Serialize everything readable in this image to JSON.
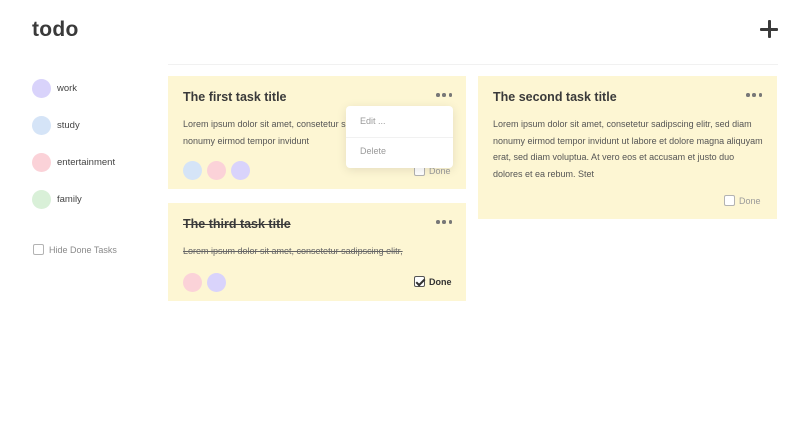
{
  "app": {
    "title": "todo"
  },
  "colors": {
    "work": "#d9d3fb",
    "study": "#d5e4f7",
    "entertainment": "#fbd2d8",
    "family": "#d9f0d8",
    "card": "#fdf6d3"
  },
  "icons": {
    "add": "plus-icon",
    "menu": "more-horizontal-icon",
    "checkbox": "checkbox-icon"
  },
  "sidebar": {
    "categories": [
      {
        "label": "work"
      },
      {
        "label": "study"
      },
      {
        "label": "entertainment"
      },
      {
        "label": "family"
      }
    ],
    "hide_done_label": "Hide Done Tasks",
    "hide_done_checked": false
  },
  "tasks": [
    {
      "title": "The first task title",
      "body": "Lorem ipsum dolor sit amet, consetetur sadipscing elitr, sed diam nonumy eirmod tempor invidunt",
      "tags": [
        "study",
        "entertainment",
        "work"
      ],
      "done_label": "Done",
      "done": false
    },
    {
      "title": "The second task title",
      "body": "Lorem ipsum dolor sit amet, consetetur sadipscing elitr, sed diam nonumy eirmod tempor invidunt ut labore et dolore magna aliquyam erat, sed diam voluptua. At vero eos et accusam et justo duo dolores et ea rebum. Stet",
      "tags": [],
      "done_label": "Done",
      "done": false
    },
    {
      "title": "The third task title",
      "body": "Lorem ipsum dolor sit amet, consetetur sadipscing elitr,",
      "tags": [
        "entertainment",
        "work"
      ],
      "done_label": "Done",
      "done": true
    }
  ],
  "card_menu": {
    "edit_label": "Edit ...",
    "delete_label": "Delete"
  }
}
